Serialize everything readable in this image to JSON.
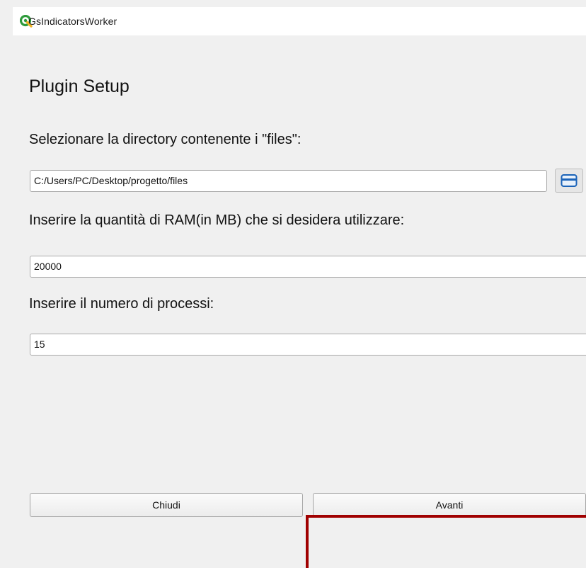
{
  "window": {
    "title": "GsIndicatorsWorker",
    "app_icon": "qgis-icon"
  },
  "page": {
    "heading": "Plugin Setup"
  },
  "files_dir": {
    "label": "Selezionare la directory contenente i \"files\":",
    "value": "C:/Users/PC/Desktop/progetto/files",
    "browse_icon": "folder-icon"
  },
  "ram": {
    "label": "Inserire la quantità di RAM(in MB) che si desidera utilizzare:",
    "value": "20000"
  },
  "processes": {
    "label": "Inserire il numero di processi:",
    "value": "15"
  },
  "buttons": {
    "close_label": "Chiudi",
    "next_label": "Avanti"
  },
  "colors": {
    "highlight": "#a00000",
    "qgis_green": "#2e9b3b"
  }
}
